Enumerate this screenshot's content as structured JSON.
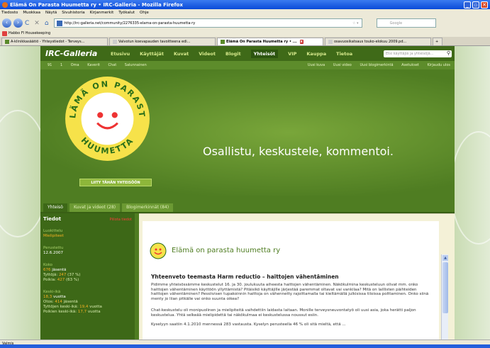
{
  "window": {
    "title": "Elämä On Parasta Huumetta ry • IRC-Galleria - Mozilla Firefox",
    "min": "_",
    "max": "▫",
    "close": "✕"
  },
  "menubar": [
    "Tiedosto",
    "Muokkaa",
    "Näytä",
    "Sivuhistoria",
    "Kirjanmerkit",
    "Työkalut",
    "Ohje"
  ],
  "nav": {
    "url": "http://irc-galleria.net/community/2276335-elama-on-parasta-huumetta-ry",
    "search_placeholder": "Google",
    "back": "‹",
    "forward": "›",
    "reload": "C",
    "stop": "✕",
    "home": "⌂",
    "star": "☆ ▾"
  },
  "bookmarks": [
    "Habbo FI Housekeeping"
  ],
  "tabs": [
    {
      "label": "A-klinikkasäätiö - Yhteystiedot - Terveys...",
      "active": false
    },
    {
      "label": "Valvotun koevapauden tavoitteena edi...",
      "active": false
    },
    {
      "label": "Elämä On Parasta Huumetta ry • ...",
      "active": true
    },
    {
      "label": "osavuosikatsaus touko-elokuu 2009.pd...",
      "active": false
    }
  ],
  "site": {
    "logo": "IRC-Galleria",
    "nav": [
      "Etusivu",
      "Käyttäjät",
      "Kuvat",
      "Videot",
      "Blogit",
      "Yhteisöt",
      "VIP",
      "Kauppa",
      "Tietoa"
    ],
    "nav_active": "Yhteisöt",
    "search_placeholder": "Etsi käyttäjiä ja yhteisöjä...",
    "subbar_left": [
      "91",
      "1",
      "Oma",
      "Kaverit",
      "Chat",
      "Salunnainen"
    ],
    "subbar_right": [
      "Uusi kuva",
      "Uusi video",
      "Uusi blogimerkintä",
      "Asetukset",
      "Kirjaudu ulos"
    ],
    "hero_text": "Osallistu, keskustele, kommentoi.",
    "badge_top": "ELÄMÄ ON PARASTA",
    "badge_bottom": "HUUMETTA",
    "join_button": "LIITY TÄHÄN YHTEISÖÖN",
    "tabs": [
      "Yhteisö",
      "Kuvat ja videot (28)",
      "Blogimerkinnät (84)"
    ],
    "tabs_active": "Yhteisö"
  },
  "info": {
    "title": "Tiedot",
    "hidden_note": "Piilota tiedot",
    "category_label": "Luokittelu",
    "category": "Mielipiteet",
    "founded_label": "Perustettu",
    "founded": "12.6.2007",
    "size_label": "Koko",
    "members_count": "676",
    "members_text": " jäsentä",
    "girls_label": "Tyttöjä: ",
    "girls": "247",
    "girls_pct": " (37 %)",
    "boys_label": "Poikia: ",
    "boys": "427",
    "boys_pct": " (63 %)",
    "age_label": "Keski-ikä",
    "age": "18,3",
    "age_unit": " vuotta",
    "sample_label": "Otos: ",
    "sample": "414",
    "sample_text": " jäsentä",
    "girls_age_label": "Tyttöjen keski-ikä: ",
    "girls_age": "19,4",
    "girls_age_unit": " vuotta",
    "boys_age_label": "Poikien keski-ikä: ",
    "boys_age": "17,7",
    "boys_age_unit": " vuotta"
  },
  "article": {
    "group_name": "Elämä on parasta huumetta ry",
    "title": "Yhteenveto teemasta Harm reductio – haittojen vähentäminen",
    "p1": "Pidimme yhteisössämme keskustelut 16. ja 30. joulukuuta aiheesta haittojen vähentäminen. Näkökulmina keskusteluun olivat mm. onko haittojen vähentäminen käyttöön yllyttämistä? Pitäisikö käyttäjille järjestää paremmat oltavat vai vankilaa? Mitä on laillisten päihteiden haittojen vähentäminen? Pessiivisen tupakoinnin haittoja on vähennetty rajoittamalla tai kieltämällä julkisissa tiloissa polttaminen. Onko siinä menty jo liian pitkälle vai onko suunta oikea?",
    "p2": "Chat-keskustelu oli monipuolinen ja mielipiteitä vaihdettiin laidasta laitaan. Monille terveysneuvontatyö oli uusi asia, joka herätti paljon keskustelua. Yhtä selkeää mielipidettä tai näkökulmaa ei keskustelussa noussut esiin.",
    "p3": "Kyselyyn saatiin 4.1.2010 mennessä 283 vastausta. Kyselyn perusteella 46 % oli sitä mieltä, että ..."
  },
  "status": "Valmis"
}
